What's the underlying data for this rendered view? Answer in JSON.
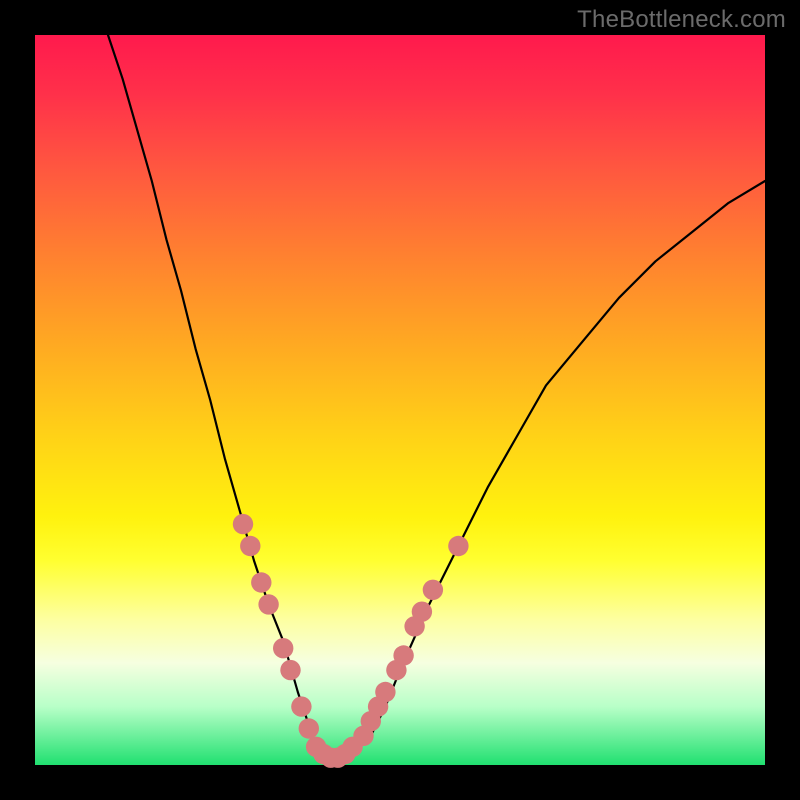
{
  "watermark": "TheBottleneck.com",
  "colors": {
    "curve_stroke": "#000000",
    "marker_fill": "#d77a7c",
    "background_black": "#000000"
  },
  "chart_data": {
    "type": "line",
    "title": "",
    "xlabel": "",
    "ylabel": "",
    "xlim": [
      0,
      100
    ],
    "ylim": [
      0,
      100
    ],
    "grid": false,
    "series": [
      {
        "name": "curve",
        "x": [
          10,
          12,
          14,
          16,
          18,
          20,
          22,
          24,
          26,
          28,
          30,
          32,
          34,
          36,
          37,
          38,
          39,
          40,
          41,
          42,
          44,
          46,
          48,
          50,
          54,
          58,
          62,
          66,
          70,
          75,
          80,
          85,
          90,
          95,
          100
        ],
        "y": [
          100,
          94,
          87,
          80,
          72,
          65,
          57,
          50,
          42,
          35,
          28,
          22,
          17,
          10,
          7,
          4,
          2,
          1,
          1,
          1,
          2,
          4,
          8,
          13,
          22,
          30,
          38,
          45,
          52,
          58,
          64,
          69,
          73,
          77,
          80
        ]
      }
    ],
    "markers": [
      {
        "x": 28.5,
        "y": 33
      },
      {
        "x": 29.5,
        "y": 30
      },
      {
        "x": 31,
        "y": 25
      },
      {
        "x": 32,
        "y": 22
      },
      {
        "x": 34,
        "y": 16
      },
      {
        "x": 35,
        "y": 13
      },
      {
        "x": 36.5,
        "y": 8
      },
      {
        "x": 37.5,
        "y": 5
      },
      {
        "x": 38.5,
        "y": 2.5
      },
      {
        "x": 39.5,
        "y": 1.5
      },
      {
        "x": 40.5,
        "y": 1
      },
      {
        "x": 41.5,
        "y": 1
      },
      {
        "x": 42.5,
        "y": 1.5
      },
      {
        "x": 43.5,
        "y": 2.5
      },
      {
        "x": 45,
        "y": 4
      },
      {
        "x": 46,
        "y": 6
      },
      {
        "x": 47,
        "y": 8
      },
      {
        "x": 48,
        "y": 10
      },
      {
        "x": 49.5,
        "y": 13
      },
      {
        "x": 50.5,
        "y": 15
      },
      {
        "x": 52,
        "y": 19
      },
      {
        "x": 53,
        "y": 21
      },
      {
        "x": 54.5,
        "y": 24
      },
      {
        "x": 58,
        "y": 30
      }
    ],
    "marker_radius": 1.4
  }
}
